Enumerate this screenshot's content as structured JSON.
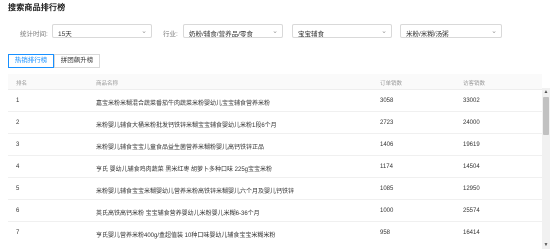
{
  "page": {
    "title": "搜索商品排行榜"
  },
  "filters": {
    "period_label": "统计时间:",
    "period_value": "15天",
    "industry_label": "行业:",
    "industry_value": "奶粉/辅食/营养品/零食",
    "category_value": "宝宝辅食",
    "subcategory_value": "米粉/米糊/汤粥"
  },
  "tabs": [
    {
      "label": "热销排行榜",
      "active": true
    },
    {
      "label": "拼团飙升榜",
      "active": false
    }
  ],
  "table": {
    "headers": {
      "rank": "排名",
      "name": "商品名称",
      "orders": "订单销数",
      "conversion": "访客销数"
    },
    "rows": [
      {
        "rank": "1",
        "name": "嘉宝米粉米糊混合蔬菜番茄牛肉蔬菜米粉婴幼儿宝宝辅食营养米粉",
        "orders": "3058",
        "conversion": "33002"
      },
      {
        "rank": "2",
        "name": "米粉婴儿辅食大桶米粉批发钙铁锌米糊宝宝辅食婴幼儿米粉1段6个月",
        "orders": "2723",
        "conversion": "24000"
      },
      {
        "rank": "3",
        "name": "米粉婴儿辅食宝宝儿童食品益生菌营养米糊粉婴儿高钙铁锌正品",
        "orders": "1406",
        "conversion": "19619"
      },
      {
        "rank": "4",
        "name": "亨氏 婴幼儿辅食鸡肉蔬菜 黑米红枣 胡萝卜多种口味 225g宝宝米粉",
        "orders": "1174",
        "conversion": "14504"
      },
      {
        "rank": "5",
        "name": "米粉婴儿辅食宝宝米糊婴幼儿营养米粉高铁锌米糊婴儿六个月及婴儿钙铁锌",
        "orders": "1085",
        "conversion": "12950"
      },
      {
        "rank": "6",
        "name": "英氏高铁高钙米粉 宝宝辅食营养婴幼儿米粉婴儿米糊6-36个月",
        "orders": "1000",
        "conversion": "25574"
      },
      {
        "rank": "7",
        "name": "亨氏婴儿营养米粉400g/盒超值装 10种口味婴幼儿辅食宝宝米糊米粉",
        "orders": "958",
        "conversion": "16414"
      }
    ]
  },
  "icons": {
    "chevron": "chevron-down-icon",
    "scroll_up": "arrow-up-icon",
    "scroll_down": "arrow-down-icon"
  },
  "colors": {
    "accent": "#1890ff"
  }
}
